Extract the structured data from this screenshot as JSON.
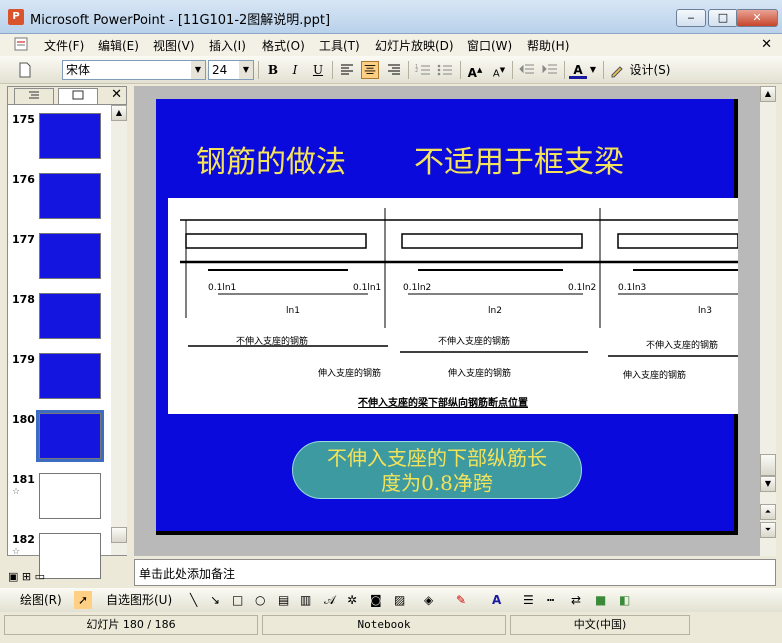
{
  "window": {
    "title": "Microsoft PowerPoint - [11G101-2图解说明.ppt]",
    "app_icon": "P",
    "buttons": {
      "minimize": "‒",
      "maximize": "□",
      "close": "✕"
    }
  },
  "menu": {
    "items": [
      "文件(F)",
      "编辑(E)",
      "视图(V)",
      "插入(I)",
      "格式(O)",
      "工具(T)",
      "幻灯片放映(D)",
      "窗口(W)",
      "帮助(H)"
    ],
    "close_doc": "✕"
  },
  "toolbar": {
    "font_name": "宋体",
    "font_size": "24",
    "bold": "B",
    "italic": "I",
    "underline": "U",
    "design_label": "设计(S)"
  },
  "outline_panel": {
    "tab_outline_icon": "outline-icon",
    "tab_slides_icon": "slides-icon",
    "close": "✕",
    "thumbnails": [
      {
        "number": "175",
        "style": "blue",
        "star": ""
      },
      {
        "number": "176",
        "style": "blue",
        "star": ""
      },
      {
        "number": "177",
        "style": "blue",
        "star": ""
      },
      {
        "number": "178",
        "style": "blue",
        "star": ""
      },
      {
        "number": "179",
        "style": "blue",
        "star": ""
      },
      {
        "number": "180",
        "style": "blue",
        "star": "",
        "selected": true
      },
      {
        "number": "181",
        "style": "white",
        "star": "☆"
      },
      {
        "number": "182",
        "style": "white",
        "star": "☆"
      }
    ]
  },
  "slide": {
    "title_left": "钢筋的做法",
    "title_right": "不适用于框支梁",
    "drawing": {
      "label_a": "不伸入支座的钢筋",
      "label_b": "伸入支座的钢筋",
      "caption": "不伸入支座的梁下部纵向钢筋断点位置",
      "marks": [
        "0.1ln1",
        "0.1ln1",
        "0.1ln2",
        "0.1ln2",
        "0.1ln3",
        "ln1",
        "ln2",
        "ln3"
      ]
    },
    "callout_line1": "不伸入支座的下部纵筋长",
    "callout_line2": "度为0.8净跨",
    "colors": {
      "background": "#0a0adc",
      "title": "#f3e35a",
      "callout_bg": "#3d9aa0"
    }
  },
  "notes": {
    "placeholder": "单击此处添加备注"
  },
  "draw_toolbar": {
    "draw_label": "绘图(R)",
    "autoshapes_label": "自选图形(U)"
  },
  "status": {
    "slide_position": "幻灯片 180 / 186",
    "template": "Notebook",
    "language": "中文(中国)"
  }
}
